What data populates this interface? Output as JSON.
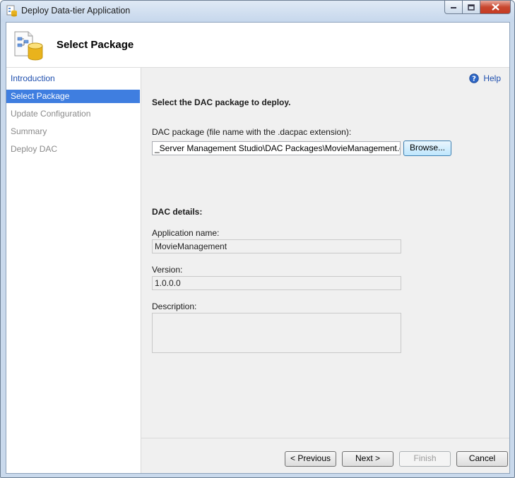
{
  "window": {
    "title": "Deploy Data-tier Application"
  },
  "header": {
    "title": "Select Package"
  },
  "sidebar": {
    "items": [
      {
        "label": "Introduction"
      },
      {
        "label": "Select Package"
      },
      {
        "label": "Update Configuration"
      },
      {
        "label": "Summary"
      },
      {
        "label": "Deploy DAC"
      }
    ]
  },
  "help": {
    "label": "Help"
  },
  "main": {
    "instruction": "Select the DAC package to deploy.",
    "package_label": "DAC package (file name with the .dacpac extension):",
    "package_value": "_Server Management Studio\\DAC Packages\\MovieManagement.dacpac",
    "browse_label": "Browse...",
    "details_heading": "DAC details:",
    "app_name_label": "Application name:",
    "app_name_value": "MovieManagement",
    "version_label": "Version:",
    "version_value": "1.0.0.0",
    "description_label": "Description:",
    "description_value": ""
  },
  "footer": {
    "previous_label": "< Previous",
    "next_label": "Next >",
    "finish_label": "Finish",
    "cancel_label": "Cancel"
  },
  "colors": {
    "selected_nav": "#3f7ee0",
    "link": "#1f4fae",
    "close_button": "#c53a22"
  }
}
